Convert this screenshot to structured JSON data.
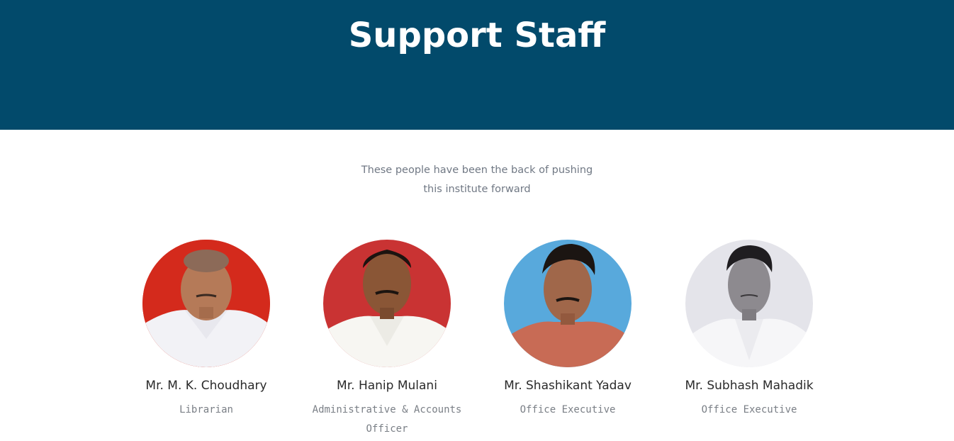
{
  "header": {
    "title": "Support Staff",
    "background_color": "#024a6b"
  },
  "intro": {
    "line1": "These people have been the back of pushing",
    "line2": "this institute forward"
  },
  "staff": [
    {
      "name": "Mr. M. K. Choudhary",
      "role": "Librarian",
      "photo_bg": "#d42a1c"
    },
    {
      "name": "Mr. Hanip Mulani",
      "role_line1": "Administrative & Accounts",
      "role_line2": "Officer",
      "photo_bg": "#c93333"
    },
    {
      "name": "Mr. Shashikant Yadav",
      "role": "Office Executive",
      "photo_bg": "#58a9dc"
    },
    {
      "name": "Mr. Subhash Mahadik",
      "role": "Office Executive",
      "photo_bg": "#e4e4ea"
    }
  ]
}
